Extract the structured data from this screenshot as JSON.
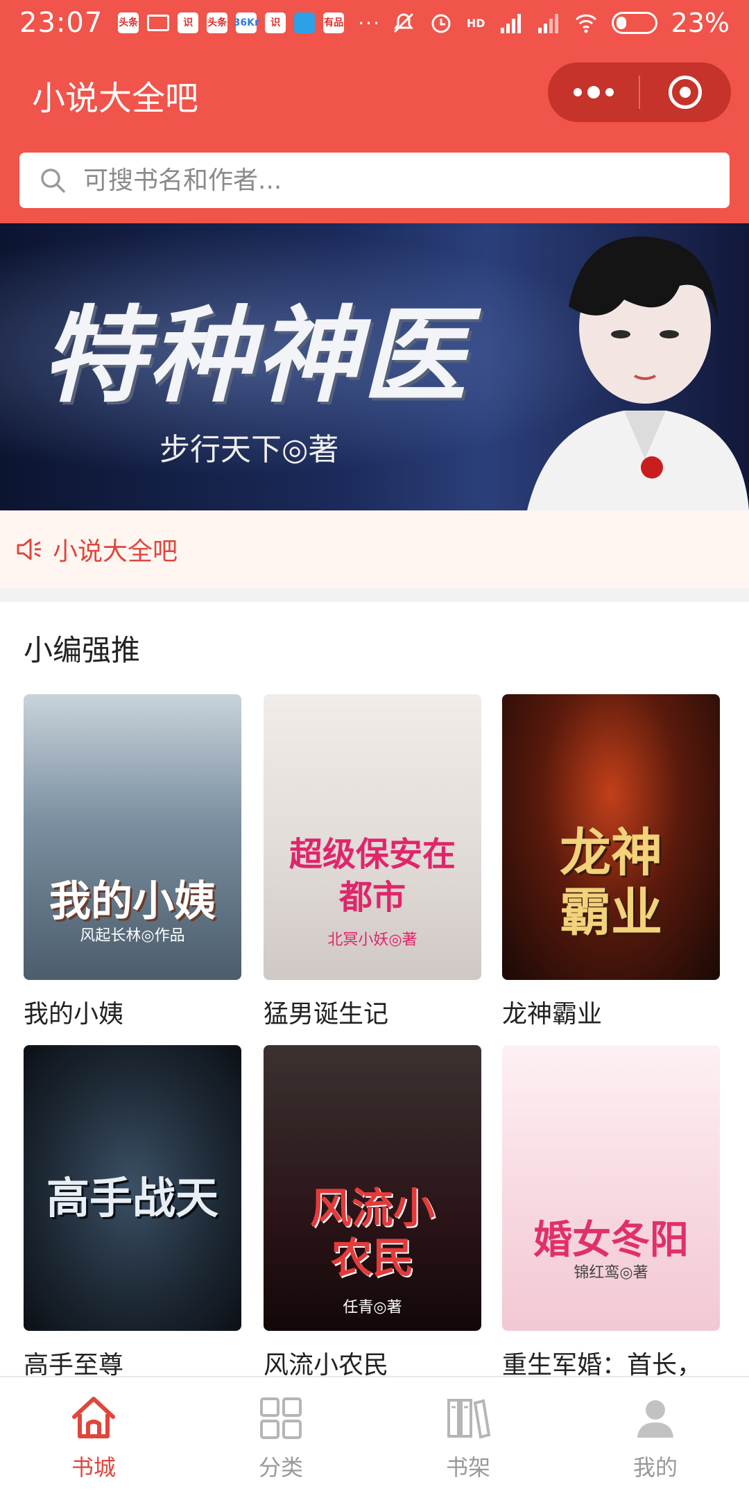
{
  "status_bar": {
    "time": "23:07",
    "notification_badges": [
      "头条",
      "识",
      "头条",
      "36Kr",
      "识",
      "有品"
    ],
    "more_dots": "···",
    "network": "HD",
    "battery_percent": "23%"
  },
  "header": {
    "title": "小说大全吧"
  },
  "search": {
    "placeholder": "可搜书名和作者..."
  },
  "banner": {
    "title": "特种神医",
    "author": "步行天下◎著"
  },
  "notice": {
    "text": "小说大全吧"
  },
  "recommended": {
    "title": "小编强推",
    "books": [
      {
        "title": "我的小姨",
        "cover_text": "我的小姨",
        "cover_sub": "风起长林◎作品",
        "cover_bg": "#7a8fa0",
        "cover_fg": "#ffffff"
      },
      {
        "title": "猛男诞生记",
        "cover_text": "超级保安在都市",
        "cover_sub": "北冥小妖◎著",
        "cover_bg": "#e9e4e2",
        "cover_fg": "#e0256b"
      },
      {
        "title": "龙神霸业",
        "cover_text": "龙神霸业",
        "cover_sub": "",
        "cover_bg": "#2a120c",
        "cover_fg": "#f2d27a"
      },
      {
        "title": "高手至尊",
        "cover_text": "高手战天",
        "cover_sub": "",
        "cover_bg": "#1e2a36",
        "cover_fg": "#e8eef5"
      },
      {
        "title": "风流小农民",
        "cover_text": "风流小农民",
        "cover_sub": "任青◎著",
        "cover_bg": "#2b1418",
        "cover_fg": "#e43a3a"
      },
      {
        "title": "重生军婚：首长，",
        "cover_text": "婚女冬阳",
        "cover_sub": "锦红鸾◎著",
        "cover_bg": "#f8dbe2",
        "cover_fg": "#e0306a"
      }
    ]
  },
  "tabs": [
    {
      "label": "书城",
      "icon": "home-icon",
      "active": true
    },
    {
      "label": "分类",
      "icon": "grid-icon",
      "active": false
    },
    {
      "label": "书架",
      "icon": "bookshelf-icon",
      "active": false
    },
    {
      "label": "我的",
      "icon": "user-icon",
      "active": false
    }
  ],
  "colors": {
    "brand": "#F0544A",
    "capsule": "#C5332A",
    "accent_text": "#E0463C",
    "inactive_tab": "#999999"
  }
}
